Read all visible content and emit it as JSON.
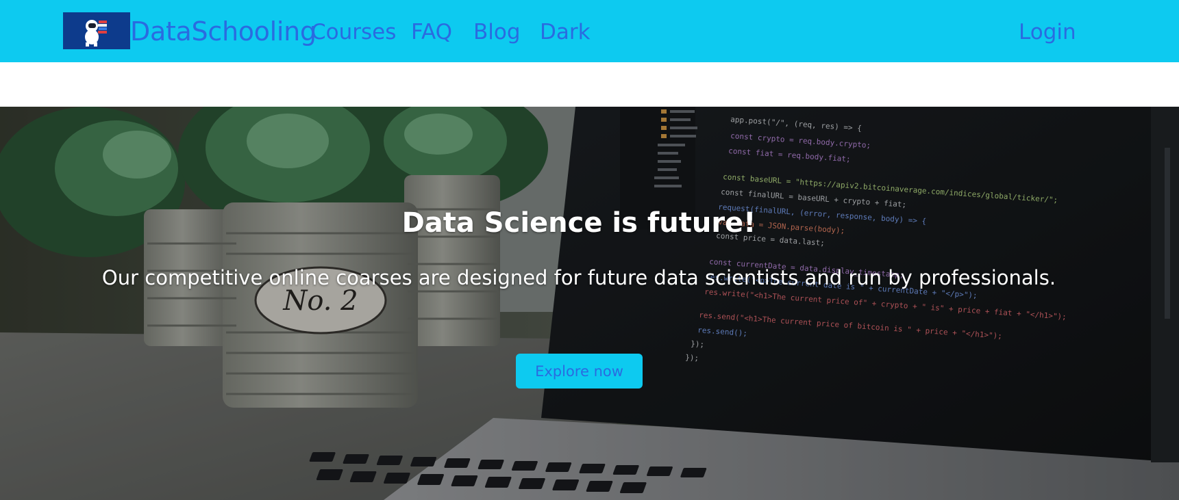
{
  "nav": {
    "logo_icon": "astronaut-with-books-logo",
    "brand": "DataSchooling",
    "links": [
      "Courses",
      "FAQ",
      "Blog",
      "Dark"
    ],
    "login": "Login"
  },
  "hero": {
    "title": "Data Science is future!",
    "subtitle": "Our competitive online coarses are designed for future data scientists and run by professionals.",
    "cta": "Explore now",
    "background": "potted-plants-and-laptop-with-code-photo",
    "code_lines": [
      "app.post(\"/\", (req, res) => {",
      "const crypto = req.body.crypto;",
      "const fiat = req.body.fiat;",
      "const baseURL = \"https://apiv2.bitcoinaverage.com/indices/global/ticker/\";",
      "const finalURL = baseURL + crypto + fiat;",
      "request(finalURL, (error, response, body) => {",
      "var data = JSON.parse(body);",
      "const price = data.last;",
      "const currentDate = data.display_timestamp;",
      "res.write(\"<p>The current date is \" + currentDate + \"</p>\");",
      "res.write(\"<h1>The current price of\" + crypto + \" is\" + price + fiat + \"</h1>\");",
      "res.send(\"<h1>The current price of bitcoin is \" + price + \"</h1>\");",
      "res.send();",
      "});",
      "});"
    ],
    "pot_label": "No. 2"
  },
  "colors": {
    "navbar_bg": "#0dcaf0",
    "link": "#2a6be0",
    "logo_bg": "#0d3b8c",
    "button_bg": "#0dcaf0"
  }
}
